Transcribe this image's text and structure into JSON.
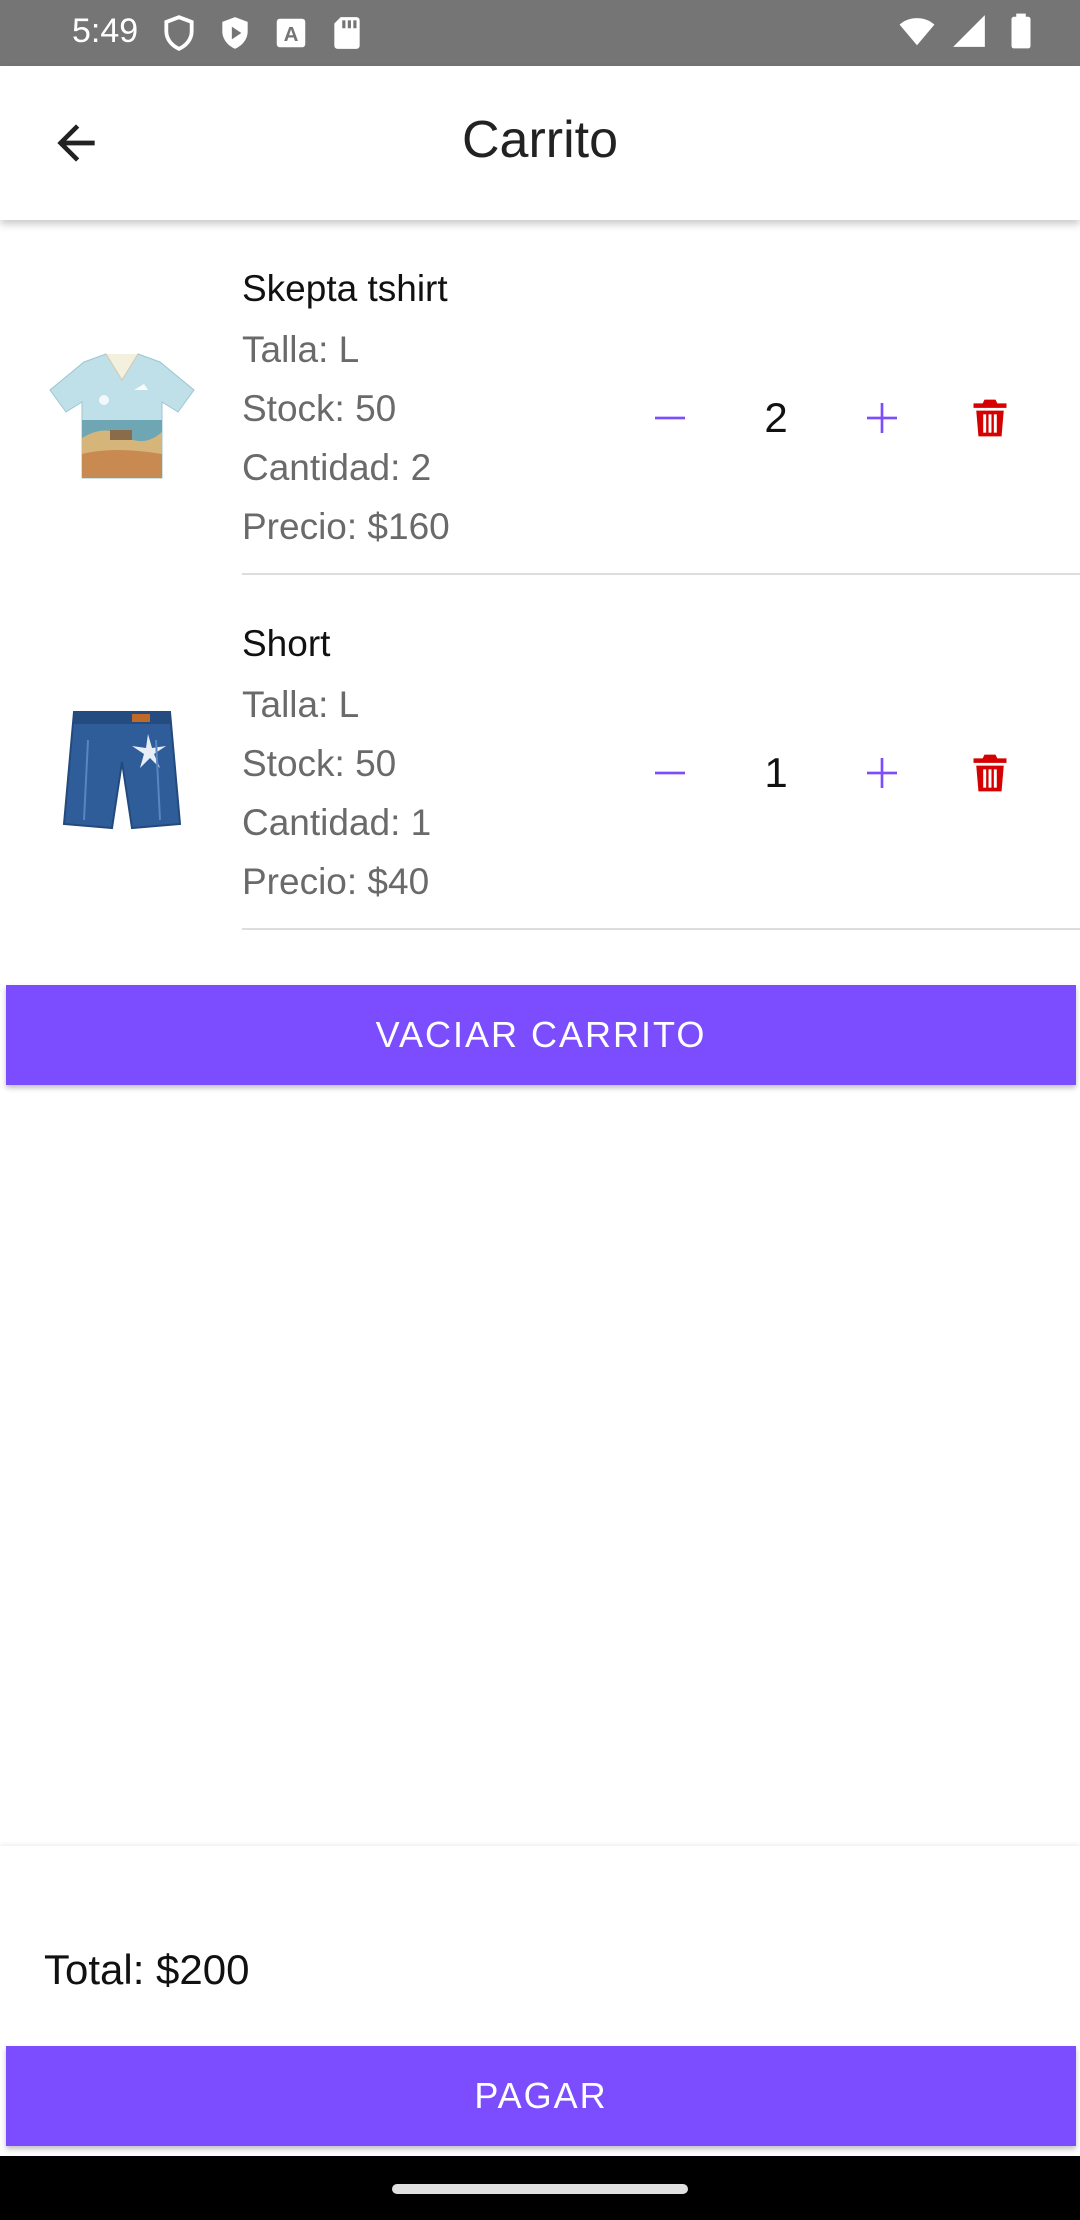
{
  "status_bar": {
    "time": "5:49",
    "icons_left": [
      "shield-icon",
      "play-icon",
      "a-icon",
      "sd-card-icon"
    ],
    "icons_right": [
      "wifi-icon",
      "signal-icon",
      "battery-icon"
    ]
  },
  "app_bar": {
    "title": "Carrito",
    "back_icon": "arrow-back-icon"
  },
  "cart": {
    "items": [
      {
        "name": "Skepta tshirt",
        "size": "Talla: L",
        "stock": "Stock: 50",
        "quantity_label": "Cantidad: 2",
        "price": "Precio: $160",
        "quantity": "2",
        "image": "shirt-image"
      },
      {
        "name": "Short",
        "size": "Talla: L",
        "stock": "Stock: 50",
        "quantity_label": "Cantidad: 1",
        "price": "Precio: $40",
        "quantity": "1",
        "image": "shorts-image"
      }
    ],
    "decrement_symbol": "—",
    "increment_symbol": "+",
    "empty_button": "VACIAR CARRITO"
  },
  "checkout": {
    "total": "Total: $200",
    "pay_button": "PAGAR"
  },
  "colors": {
    "accent": "#7c4dff",
    "delete": "#d50000",
    "status_bar": "#757575"
  }
}
